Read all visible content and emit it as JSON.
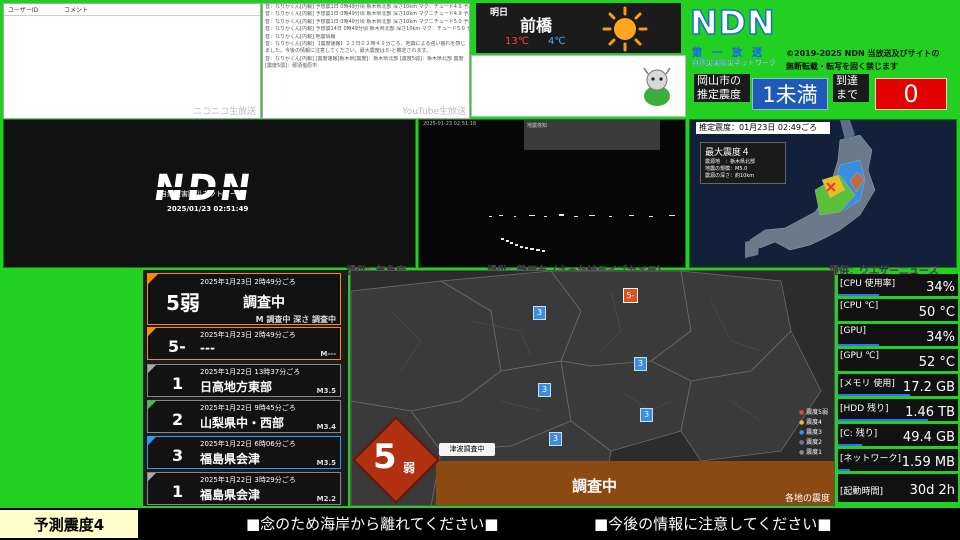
{
  "comments": {
    "col_user": "ユーザーID",
    "col_comment": "コメント",
    "caption": "ニコニコ生放送"
  },
  "youtube": {
    "caption": "YouTube生放送",
    "lines": [
      "音：なりかくん[内報] 予想震1日 0時49分頃 栃木県北部 深さ10km マグ：チュード4.9 予想震度4",
      "音：なりかくん[内報] 予想震1日 0時49分頃 栃木県北部 深さ10km マグニチュード4.9 予想震度4",
      "音：なりかくん[内報] 予想震1日 0時49分頃 栃木県北部 深さ10km マグニチュード5.0 予想震度4",
      "音：なりかくん[内報] 予想震14日 0時49分頃 栃木県北部 深さ10km マグ：チュード5.0 予想震度4",
      "音：なりかくん[内報] 地震情報",
      "音：なりかくん[内報] 【震度速報】２３日０２時４９分ごろ、地震による強い揺れを感じました。今後の情報に注意してください。最大震度は５-と推定されます。",
      "音：なりかくん[内報] [震度速報]栃木県[震度]：栃木県北部 [震度5弱]：栃木県北部 震度[震度5弱]：那須塩原市"
    ]
  },
  "weather": {
    "day": "明日",
    "city": "前橋",
    "high": "13℃",
    "low": "4℃",
    "icon": "sun-icon"
  },
  "ndn": {
    "logo": "NDN",
    "sub1": "第　一　放　送",
    "sub2": "自然災害防災ネットワーク",
    "copy1": "©2019-2025 NDN 当放送及びサイトの",
    "copy2": "無断転載・転写を固く禁じます",
    "est_label": "岡山市の推定震度",
    "est_value": "1未満",
    "arr_label": "到達まで",
    "arr_value": "0"
  },
  "nico_panel": {
    "logo": "NDN",
    "subtitle": "自然災害防災ネットワーク",
    "timestamp": "2025/01/23 02:51:49"
  },
  "live_panel": {
    "timestamp": "2025-01-23 02:51:18",
    "label": "地震検知"
  },
  "weather_map": {
    "header": "推定震度：01月23日 02:49ごろ",
    "max": "最大震度４",
    "l1": "震源地　：栃木県北部",
    "l2": "地震の規模：M5.0",
    "l3": "震源の深さ：約10km"
  },
  "credits": {
    "jma": "提供：気象庁",
    "shizuoka": "提供：静岡市（さった峠ライブカメラ）",
    "wni": "提供：ウエザーニュース"
  },
  "quakes": [
    {
      "date": "2025年1月23日 2時49分ごろ",
      "shindo": "5弱",
      "place": "調査中",
      "mag": "M 調査中 深さ 調査中",
      "color": "#ff8c00"
    },
    {
      "date": "2025年1月23日 2時49分ごろ",
      "shindo": "5-",
      "place": "---",
      "mag": "M---",
      "color": "#ff8c00"
    },
    {
      "date": "2025年1月22日 13時37分ごろ",
      "shindo": "1",
      "place": "日高地方東部",
      "mag": "M3.5",
      "color": "#aaaaaa"
    },
    {
      "date": "2025年1月22日 9時45分ごろ",
      "shindo": "2",
      "place": "山梨県中・西部",
      "mag": "M3.4",
      "color": "#3ec43e"
    },
    {
      "date": "2025年1月22日 6時06分ごろ",
      "shindo": "3",
      "place": "福島県会津",
      "mag": "M3.5",
      "color": "#2a9ef0"
    },
    {
      "date": "2025年1月22日 3時29分ごろ",
      "shindo": "1",
      "place": "福島県会津",
      "mag": "M2.2",
      "color": "#aaaaaa"
    }
  ],
  "main_map": {
    "big_shindo": "5",
    "big_shindo_sub": "弱",
    "tsunami": "津波調査中",
    "status": "調査中",
    "footer": "各地の震度",
    "legend": [
      "震度5弱",
      "震度4",
      "震度3",
      "震度2",
      "震度1"
    ],
    "legend_colors": [
      "#e05020",
      "#e8c020",
      "#3a8ee0",
      "#6a7a9a",
      "#8a8a8a"
    ],
    "markers": [
      "5-",
      "3",
      "3",
      "3",
      "3",
      "3"
    ]
  },
  "stats": [
    {
      "label": "[CPU 使用率]",
      "value": "34%",
      "bar": 0.34
    },
    {
      "label": "[CPU ℃]",
      "value": "50 °C",
      "bar": 0
    },
    {
      "label": "[GPU]",
      "value": "34%",
      "bar": 0.34
    },
    {
      "label": "[GPU ℃]",
      "value": "52 °C",
      "bar": 0
    },
    {
      "label": "[メモリ 使用]",
      "value": "17.2 GB",
      "bar": 0.6
    },
    {
      "label": "[HDD 残り]",
      "value": "1.46 TB",
      "bar": 0.75
    },
    {
      "label": "[C: 残り]",
      "value": "49.4 GB",
      "bar": 0.2
    },
    {
      "label": "[ネットワーク]",
      "value": "1.59 MB",
      "bar": 0.1
    },
    {
      "label": "[起動時間]",
      "value": "30d 2h",
      "bar": 0
    }
  ],
  "bottom": {
    "label": "予測震度4",
    "msg1": "■念のため海岸から離れてください■",
    "msg2": "■今後の情報に注意してください■"
  }
}
